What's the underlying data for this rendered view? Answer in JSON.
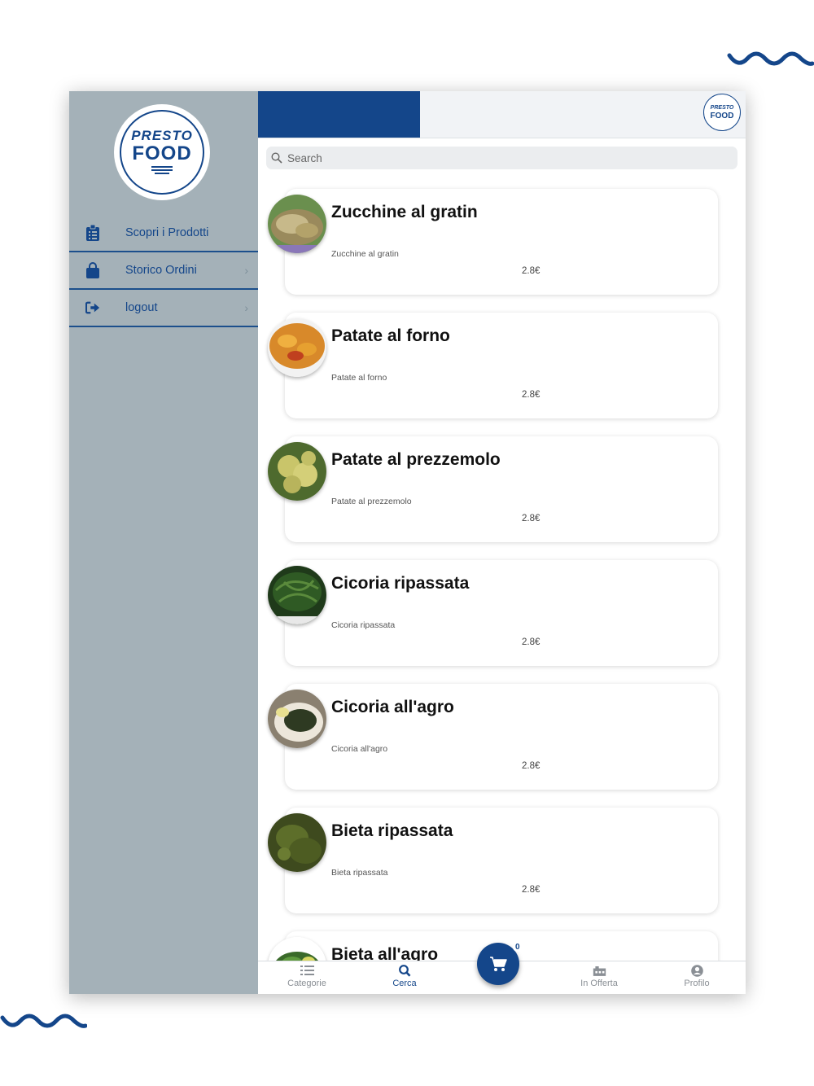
{
  "app": {
    "logo_line1": "PRESTO",
    "logo_line2": "FOOD"
  },
  "colors": {
    "brand": "#14468a",
    "sidebar_bg": "#a4b1b8",
    "topbar_bg": "#f1f3f6"
  },
  "sidebar": {
    "items": [
      {
        "label": "Scopri i Prodotti",
        "icon": "clipboard-list-icon",
        "chevron": false
      },
      {
        "label": "Storico Ordini",
        "icon": "shopping-bag-icon",
        "chevron": true
      },
      {
        "label": "logout",
        "icon": "sign-out-icon",
        "chevron": true
      }
    ]
  },
  "search": {
    "placeholder": "Search"
  },
  "products": [
    {
      "title": "Zucchine al gratin",
      "description": "Zucchine al gratin",
      "price": "2.8€"
    },
    {
      "title": "Patate al forno",
      "description": "Patate al forno",
      "price": "2.8€"
    },
    {
      "title": "Patate al prezzemolo",
      "description": "Patate al prezzemolo",
      "price": "2.8€"
    },
    {
      "title": "Cicoria ripassata",
      "description": "Cicoria ripassata",
      "price": "2.8€"
    },
    {
      "title": "Cicoria all'agro",
      "description": "Cicoria all'agro",
      "price": "2.8€"
    },
    {
      "title": "Bieta ripassata",
      "description": "Bieta ripassata",
      "price": "2.8€"
    },
    {
      "title": "Bieta all'agro",
      "description": "",
      "price": ""
    }
  ],
  "tabbar": {
    "tabs": [
      {
        "label": "Categorie",
        "icon": "list-icon"
      },
      {
        "label": "Cerca",
        "icon": "search-icon",
        "active": true
      },
      {
        "label": "In Offerta",
        "icon": "store-icon"
      },
      {
        "label": "Profilo",
        "icon": "user-circle-icon"
      }
    ],
    "cart_count": "0"
  }
}
